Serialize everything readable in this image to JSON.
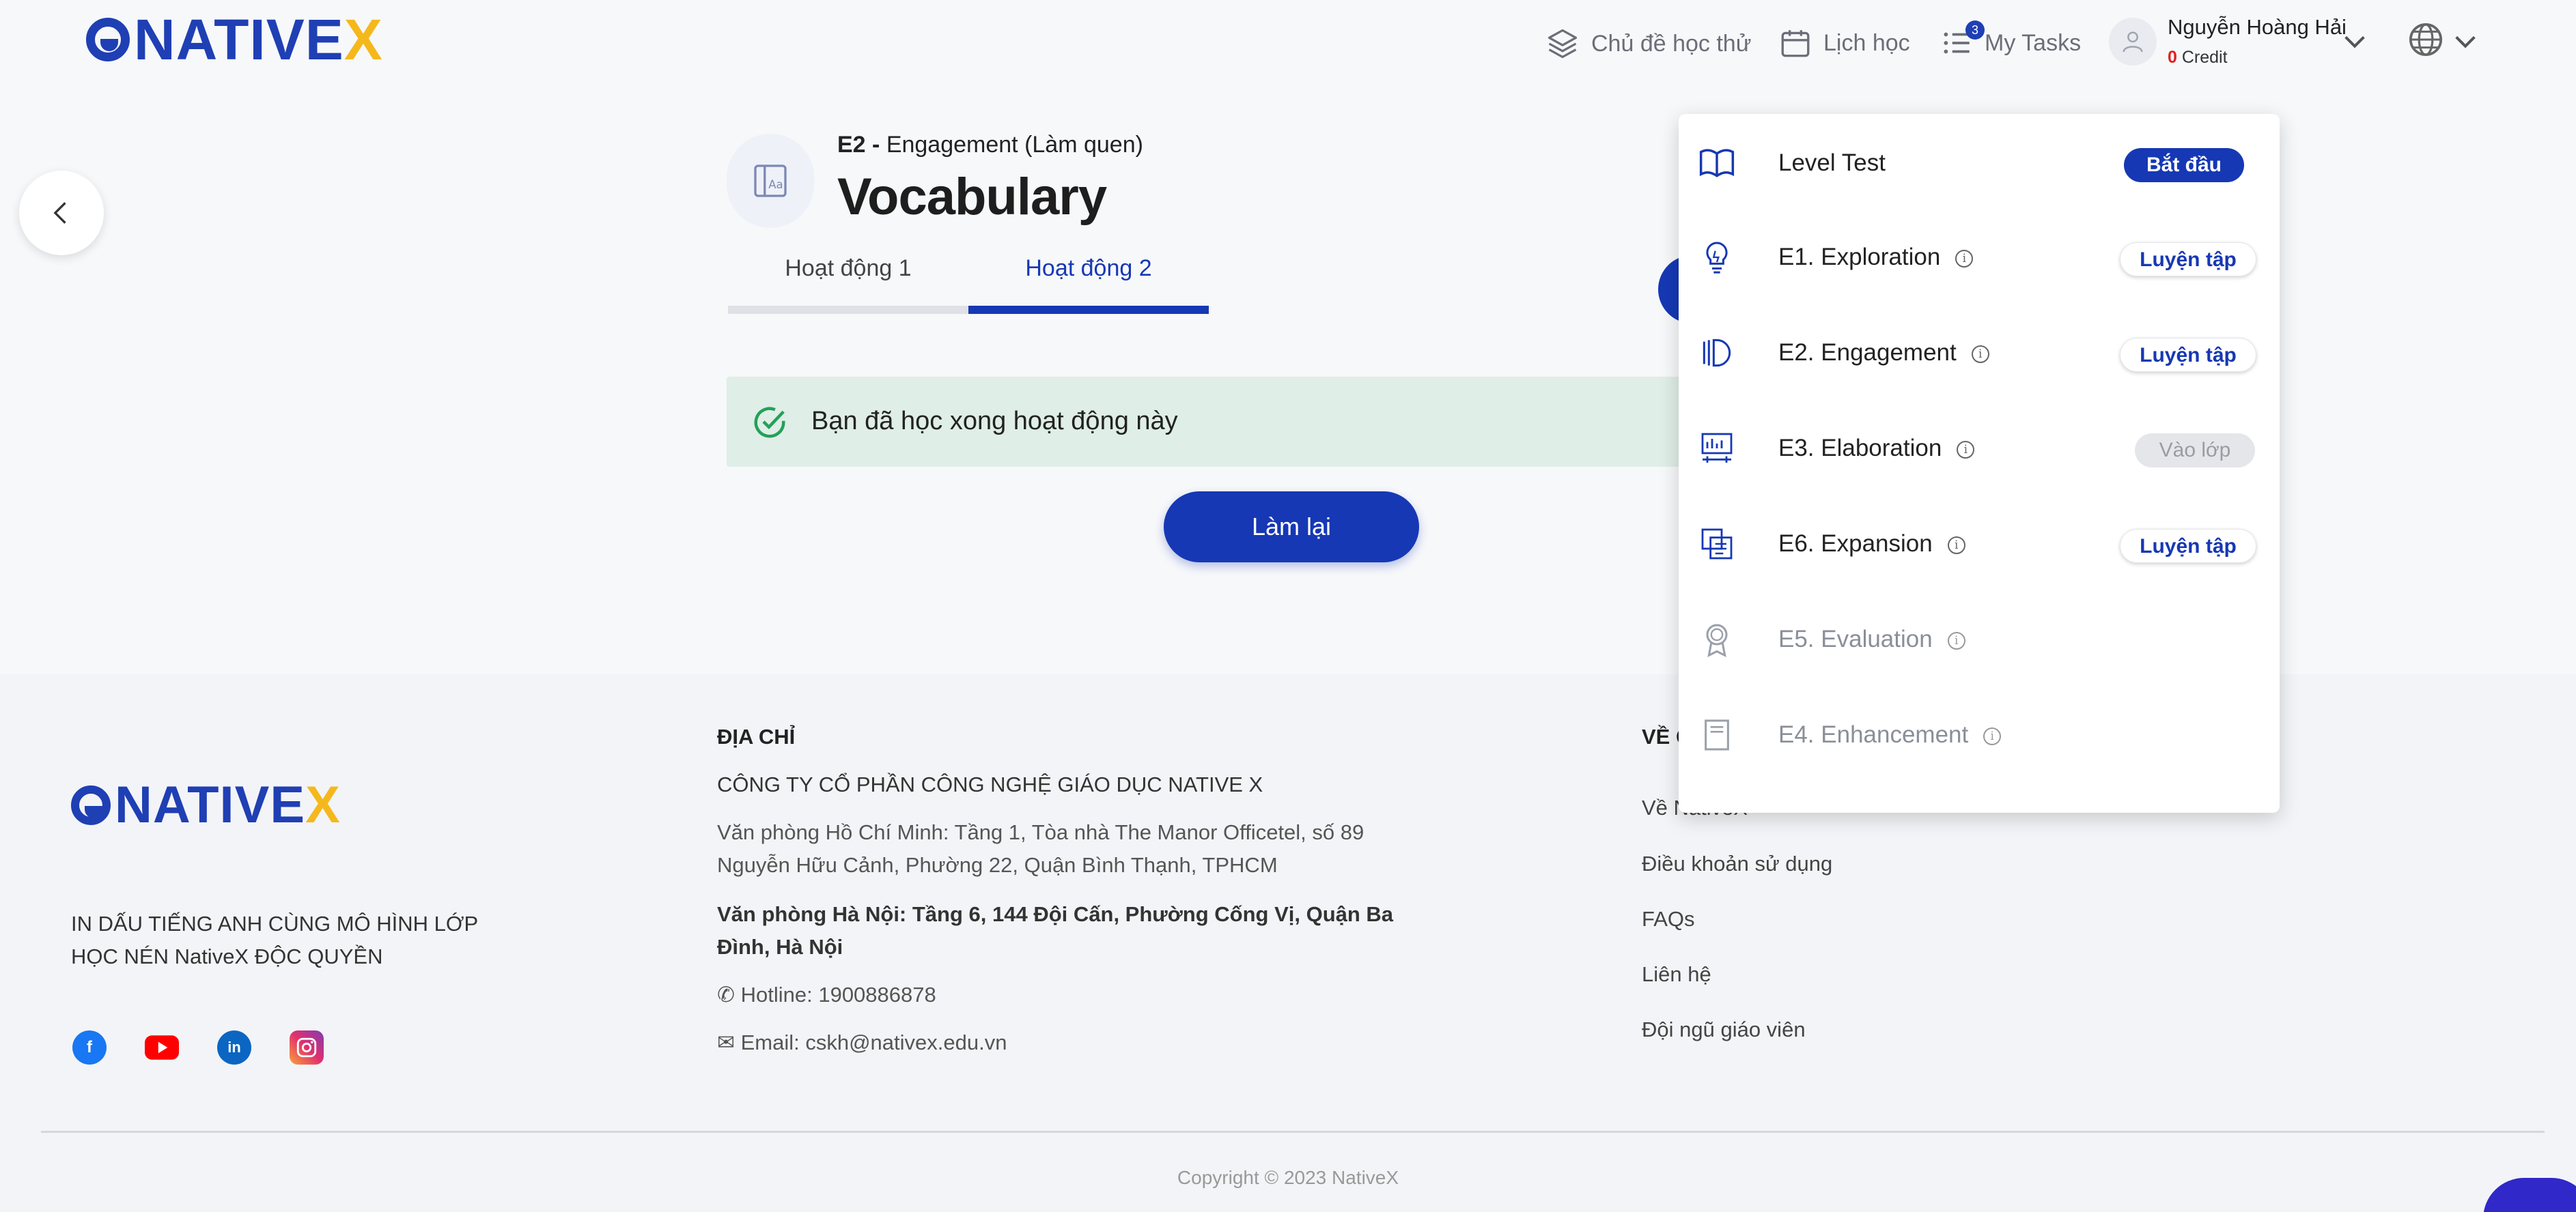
{
  "brand": {
    "logo_text": "NATIVE",
    "logo_x": "X",
    "primary_color": "#1638b4",
    "accent_color": "#f5b81c"
  },
  "header": {
    "nav": [
      {
        "label": "Chủ đề học thử",
        "icon": "layers-icon"
      },
      {
        "label": "Lịch học",
        "icon": "calendar-icon"
      },
      {
        "label": "My Tasks",
        "icon": "task-list-icon",
        "badge": "3"
      }
    ],
    "user": {
      "name": "Nguyễn Hoàng Hải",
      "credit_value": "0",
      "credit_label": "Credit"
    }
  },
  "lesson": {
    "code": "E2 -",
    "phase": "Engagement (Làm quen)",
    "title": "Vocabulary",
    "tabs": [
      {
        "label": "Hoạt động 1",
        "active": false
      },
      {
        "label": "Hoạt động 2",
        "active": true
      }
    ],
    "status_message": "Bạn đã học xong hoạt động này",
    "redo_label": "Làm lại"
  },
  "dropdown": {
    "items": [
      {
        "label": "Level Test",
        "action": "Bắt đầu",
        "state": "primary",
        "info": false,
        "muted": false
      },
      {
        "label": "E1. Exploration",
        "action": "Luyện tập",
        "state": "outline",
        "info": true,
        "muted": false
      },
      {
        "label": "E2. Engagement",
        "action": "Luyện tập",
        "state": "outline",
        "info": true,
        "muted": false
      },
      {
        "label": "E3. Elaboration",
        "action": "Vào lớp",
        "state": "disabled",
        "info": true,
        "muted": false
      },
      {
        "label": "E6. Expansion",
        "action": "Luyện tập",
        "state": "outline",
        "info": true,
        "muted": false
      },
      {
        "label": "E5. Evaluation",
        "action": "",
        "state": "none",
        "info": true,
        "muted": true
      },
      {
        "label": "E4. Enhancement",
        "action": "",
        "state": "none",
        "info": true,
        "muted": true
      }
    ]
  },
  "footer": {
    "slogan_line1": "IN DẤU TIẾNG ANH CÙNG MÔ HÌNH LỚP",
    "slogan_line2": "HỌC NÉN NativeX ĐỘC QUYỀN",
    "address_heading": "ĐỊA CHỈ",
    "company": "CÔNG TY CỔ PHẦN CÔNG NGHỆ GIÁO DỤC NATIVE X",
    "hcm_line1": "Văn phòng Hồ Chí Minh: Tầng 1, Tòa nhà The Manor Officetel, số 89",
    "hcm_line2": "Nguyễn Hữu Cảnh, Phường 22, Quận Bình Thạnh, TPHCM",
    "hn_line1": "Văn phòng Hà Nội: Tầng 6, 144 Đội Cấn, Phường Cống Vị, Quận Ba",
    "hn_line2": "Đình, Hà Nội",
    "hotline": "Hotline: 1900886878",
    "email": "Email: cskh@nativex.edu.vn",
    "about_heading_partial": "VỀ C",
    "links": [
      "Về NativeX",
      "Điều khoản sử dụng",
      "FAQs",
      "Liên hệ",
      "Đội ngũ giáo viên"
    ],
    "copyright": "Copyright © 2023 NativeX"
  }
}
